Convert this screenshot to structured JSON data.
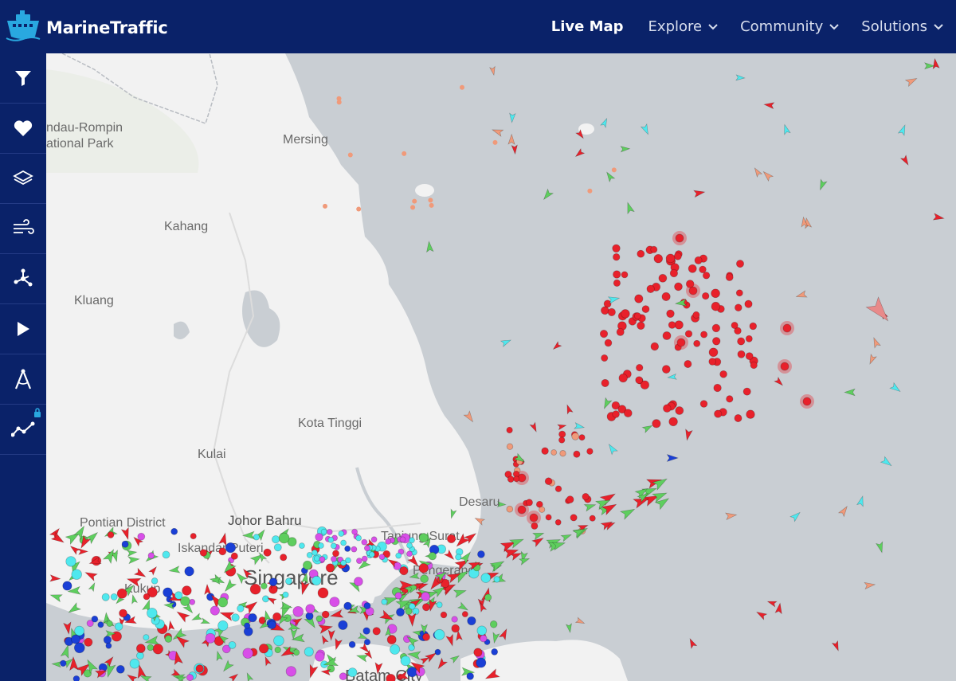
{
  "brand": {
    "name": "MarineTraffic"
  },
  "nav": {
    "items": [
      {
        "label": "Live Map",
        "active": true,
        "dropdown": false
      },
      {
        "label": "Explore",
        "active": false,
        "dropdown": true
      },
      {
        "label": "Community",
        "active": false,
        "dropdown": true
      },
      {
        "label": "Solutions",
        "active": false,
        "dropdown": true
      }
    ]
  },
  "sidebar": {
    "buttons": [
      {
        "icon": "filter-icon"
      },
      {
        "icon": "heart-icon"
      },
      {
        "icon": "layers-icon"
      },
      {
        "icon": "wind-icon"
      },
      {
        "icon": "network-icon"
      },
      {
        "icon": "play-icon"
      },
      {
        "icon": "compass-icon"
      },
      {
        "icon": "analytics-icon",
        "locked": true
      }
    ]
  },
  "map": {
    "labels": {
      "rompin": "ndau-Rompin",
      "park": "ational Park",
      "mersing": "Mersing",
      "kahang": "Kahang",
      "kluang": "Kluang",
      "kota_tinggi": "Kota Tinggi",
      "kulai": "Kulai",
      "desaru": "Desaru",
      "pontian": "Pontian District",
      "johor_bahru": "Johor Bahru",
      "iskandar": "Iskandar Puteri",
      "tanjung_surat": "Tanjung Surat",
      "kukup": "Kukup",
      "singapore": "Singapore",
      "pengerang": "Pengerang",
      "batam": "Batam City"
    },
    "colors": {
      "sea": "#c9ced3",
      "land": "#f2f2f2",
      "tanker": "#e8212b",
      "cargo": "#5ece5e",
      "passenger": "#1a3fd6",
      "tug": "#4fe8ee",
      "pleasure": "#d84fe8",
      "fishing": "#f09a7a",
      "unknown": "#bdbdbd"
    }
  }
}
